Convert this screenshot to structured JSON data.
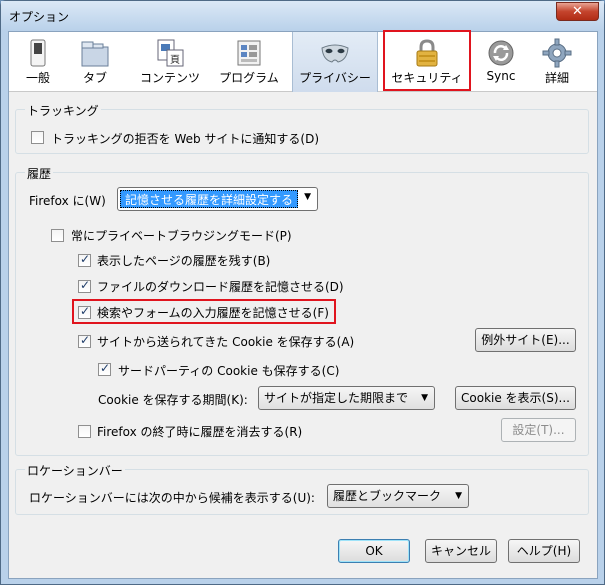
{
  "window": {
    "title": "オプション",
    "close_label": "✕"
  },
  "toolbar": {
    "tabs": [
      {
        "label": "一般",
        "icon": "switch-icon"
      },
      {
        "label": "タブ",
        "icon": "tabs-folder-icon"
      },
      {
        "label": "コンテンツ",
        "icon": "content-page-icon"
      },
      {
        "label": "プログラム",
        "icon": "applications-icon"
      },
      {
        "label": "プライバシー",
        "icon": "privacy-mask-icon",
        "selected": true
      },
      {
        "label": "セキュリティ",
        "icon": "padlock-icon"
      },
      {
        "label": "Sync",
        "icon": "sync-icon"
      },
      {
        "label": "詳細",
        "icon": "gear-icon"
      }
    ]
  },
  "tracking": {
    "legend": "トラッキング",
    "dnt_label": "トラッキングの拒否を Web サイトに通知する(D)",
    "dnt_checked": false
  },
  "history": {
    "legend": "履歴",
    "firefox_will_label": "Firefox に(W)",
    "mode_value": "記憶させる履歴を詳細設定する",
    "private_mode_label": "常にプライベートブラウジングモード(P)",
    "private_mode_checked": false,
    "browsing_label": "表示したページの履歴を残す(B)",
    "browsing_checked": true,
    "downloads_label": "ファイルのダウンロード履歴を記憶させる(D)",
    "downloads_checked": true,
    "forms_label": "検索やフォームの入力履歴を記憶させる(F)",
    "forms_checked": true,
    "cookies_label": "サイトから送られてきた Cookie を保存する(A)",
    "cookies_checked": true,
    "exceptions_button": "例外サイト(E)...",
    "third_party_label": "サードパーティの Cookie も保存する(C)",
    "third_party_checked": true,
    "keep_until_label": "Cookie を保存する期間(K):",
    "keep_until_value": "サイトが指定した期限まで",
    "show_cookies_button": "Cookie を表示(S)...",
    "clear_on_close_label": "Firefox の終了時に履歴を消去する(R)",
    "clear_on_close_checked": false,
    "settings_button": "設定(T)..."
  },
  "location_bar": {
    "legend": "ロケーションバー",
    "suggest_label": "ロケーションバーには次の中から候補を表示する(U):",
    "suggest_value": "履歴とブックマーク"
  },
  "footer": {
    "ok": "OK",
    "cancel": "キャンセル",
    "help": "ヘルプ(H)"
  },
  "colors": {
    "highlight": "#e0141e",
    "selection": "#3399ff"
  }
}
